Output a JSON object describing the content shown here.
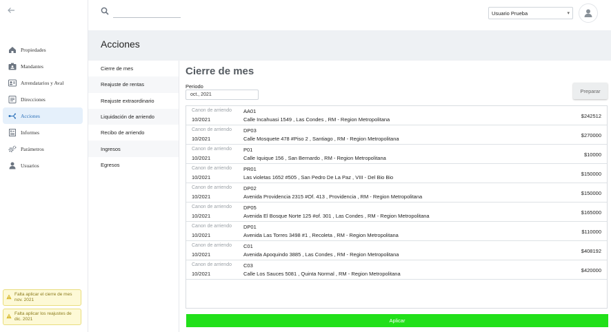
{
  "sidebar": {
    "items": [
      {
        "label": "Propiedades",
        "icon": "home-icon",
        "active": false
      },
      {
        "label": "Mandantes",
        "icon": "id-card-icon",
        "active": false
      },
      {
        "label": "Arrendatarios y Aval",
        "icon": "contact-card-icon",
        "active": false
      },
      {
        "label": "Direcciones",
        "icon": "address-icon",
        "active": false
      },
      {
        "label": "Acciones",
        "icon": "actions-icon",
        "active": true
      },
      {
        "label": "Informes",
        "icon": "report-icon",
        "active": false
      },
      {
        "label": "Parámetros",
        "icon": "gears-icon",
        "active": false
      },
      {
        "label": "Usuarios",
        "icon": "user-icon",
        "active": false
      }
    ],
    "alerts": [
      {
        "text": "Falta aplicar el cierre de mes nov. 2021"
      },
      {
        "text": "Falta aplicar los reajustes de dic. 2021"
      }
    ]
  },
  "topbar": {
    "search_placeholder": "",
    "user_select": "Usuario Prueba"
  },
  "header": {
    "title": "Acciones"
  },
  "submenu": {
    "items": [
      "Cierre de mes",
      "Reajuste de rentas",
      "Reajuste extraordinario",
      "Liquidación de arriendo",
      "Recibo de arriendo",
      "Ingresos",
      "Egresos"
    ]
  },
  "main": {
    "title": "Cierre de mes",
    "period_label": "Periodo",
    "period_value": "oct., 2021",
    "prepare_label": "Preparar",
    "apply_label": "Aplicar",
    "rows": [
      {
        "kind": "Canon de arriendo",
        "date": "10/2021",
        "code": "AA01",
        "address": "Calle Incahuasi 1549 , Las Condes , RM - Region Metropolitana",
        "amount": "$242512"
      },
      {
        "kind": "Canon de arriendo",
        "date": "10/2021",
        "code": "DP03",
        "address": "Calle Mosquete 478 #Piso 2 , Santiago , RM - Region Metropolitana",
        "amount": "$270000"
      },
      {
        "kind": "Canon de arriendo",
        "date": "10/2021",
        "code": "P01",
        "address": "Calle Iquique 156 , San Bernardo , RM - Region Metropolitana",
        "amount": "$10000"
      },
      {
        "kind": "Canon de arriendo",
        "date": "10/2021",
        "code": "PR01",
        "address": "Las violetas 1652 #505 , San Pedro De La Paz , VIII - Del Bio Bio",
        "amount": "$150000"
      },
      {
        "kind": "Canon de arriendo",
        "date": "10/2021",
        "code": "DP02",
        "address": "Avenida Providencia 2315 #Of. 413 , Providencia , RM - Region Metropolitana",
        "amount": "$150000"
      },
      {
        "kind": "Canon de arriendo",
        "date": "10/2021",
        "code": "DP05",
        "address": "Avenida El Bosque Norte 125 #of. 301 , Las Condes , RM - Region Metropolitana",
        "amount": "$165000"
      },
      {
        "kind": "Canon de arriendo",
        "date": "10/2021",
        "code": "DP01",
        "address": "Avenida Las Torres 3498 #1 , Recoleta , RM - Region Metropolitana",
        "amount": "$110000"
      },
      {
        "kind": "Canon de arriendo",
        "date": "10/2021",
        "code": "C01",
        "address": "Avenida Apoquindo 3885 , Las Condes , RM - Region Metropolitana",
        "amount": "$408192"
      },
      {
        "kind": "Canon de arriendo",
        "date": "10/2021",
        "code": "C03",
        "address": "Calle Los Sauces 5081 , Quinta Normal , RM - Region Metropolitana",
        "amount": "$420000"
      }
    ]
  },
  "colors": {
    "accent": "#2a6fb8",
    "apply_green": "#22e01a",
    "header_band": "#eef1f4",
    "alert_bg": "#fdf9d6"
  }
}
